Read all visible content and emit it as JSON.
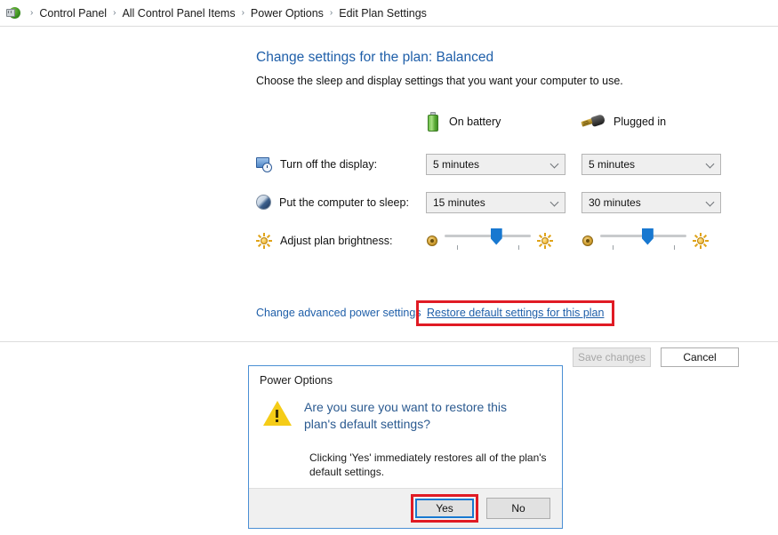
{
  "breadcrumb": {
    "icon": "power-plug-icon",
    "items": [
      {
        "label": "Control Panel"
      },
      {
        "label": "All Control Panel Items"
      },
      {
        "label": "Power Options"
      },
      {
        "label": "Edit Plan Settings"
      }
    ],
    "separator": "›"
  },
  "main": {
    "title": "Change settings for the plan: Balanced",
    "subtitle": "Choose the sleep and display settings that you want your computer to use.",
    "columns": [
      {
        "icon": "battery-icon",
        "label": "On battery"
      },
      {
        "icon": "power-plug-icon",
        "label": "Plugged in"
      }
    ],
    "rows": [
      {
        "icon": "display-clock-icon",
        "label": "Turn off the display:",
        "on_battery": "5 minutes",
        "plugged_in": "5 minutes"
      },
      {
        "icon": "sleep-moon-icon",
        "label": "Put the computer to sleep:",
        "on_battery": "15 minutes",
        "plugged_in": "30 minutes"
      }
    ],
    "brightness": {
      "icon": "sun-icon",
      "label": "Adjust plan brightness:",
      "on_battery_percent": 60,
      "plugged_in_percent": 55,
      "low_icon": "sun-dim-icon",
      "high_icon": "sun-bright-icon"
    },
    "links": {
      "advanced": "Change advanced power settings",
      "restore": "Restore default settings for this plan"
    },
    "footer": {
      "save_label": "Save changes",
      "save_disabled": true,
      "cancel_label": "Cancel"
    }
  },
  "dialog": {
    "title": "Power Options",
    "icon": "warning-triangle-icon",
    "heading": "Are you sure you want to restore this plan's default settings?",
    "body": "Clicking 'Yes' immediately restores all of the plan's default settings.",
    "yes_label": "Yes",
    "no_label": "No"
  },
  "colors": {
    "link": "#1f5fa9",
    "title": "#1f5fa9",
    "annotation": "#e01b24",
    "focus": "#1878d0",
    "warning": "#f5cc17",
    "battery": "#5bab37"
  }
}
